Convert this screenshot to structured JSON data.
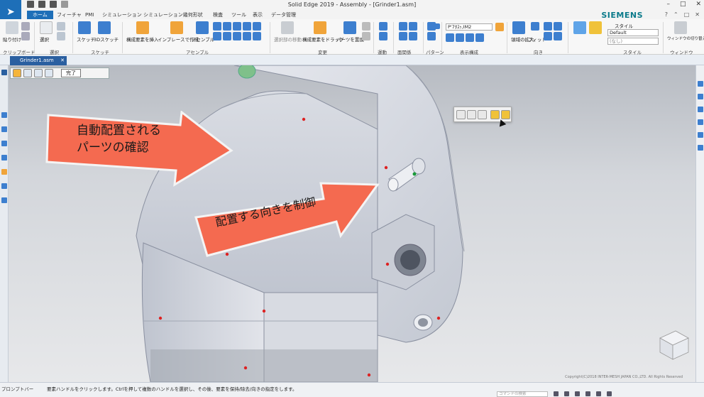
{
  "app": {
    "title": "Solid Edge 2019 - Assembly - [Grinder1.asm]",
    "brand": "SIEMENS"
  },
  "tabs": [
    "ホーム",
    "フィーチャ",
    "PMI",
    "シミュレーション",
    "シミュレーション幾何形状",
    "検査",
    "ツール",
    "表示",
    "データ管理"
  ],
  "ribbon": {
    "groups": [
      "クリップボード",
      "選択",
      "スケッチ",
      "アセンブル",
      "変更",
      "運動",
      "面関係",
      "パターン",
      "表示構成",
      "向き",
      "スタイル",
      "ウィンドウ"
    ],
    "labels": {
      "paste": "貼り付け",
      "select": "選択",
      "sketch": "スケッチ",
      "sketch3d": "3Dスケッチ",
      "insert_component": "構成要素を挿入",
      "create_inplace": "インプレースで作成",
      "assemble": "アセンブル",
      "drag_component": "構成要素をドラッグ",
      "replace_part": "パーツを置換",
      "move_selected": "選択部の移動",
      "zoom_area": "領域の拡大",
      "fit": "フィット",
      "switch_window": "ウィンドウの切り替え",
      "style_label": "スタイル",
      "style_value": "Default",
      "none_value": "(なし)",
      "display_config": "P'7ﾀｽｯ,IM2"
    }
  },
  "document_tab": "Grinder1.asm",
  "command_bar": {
    "done_label": "完了"
  },
  "callouts": {
    "auto_place": [
      "自動配置される",
      "パーツの確認"
    ],
    "orientation": "配置する向きを制御"
  },
  "status": {
    "prompt_label": "プロンプトバー",
    "prompt_text": "要素ハンドルをクリックします。Ctrlを押して複数のハンドルを選択し、その後、要素を保持/除去/向きの指定をします。",
    "command_finder_placeholder": "コマンドの検索",
    "copyright": "Copyright(C)2018 INTER-MESH JAPAN CO.,LTD. All Rights Reserved"
  },
  "colors": {
    "accent": "#1e6fb8",
    "brand": "#0a7a8a",
    "callout_fill": "#f46a50",
    "callout_stroke": "#f4f4f4"
  }
}
